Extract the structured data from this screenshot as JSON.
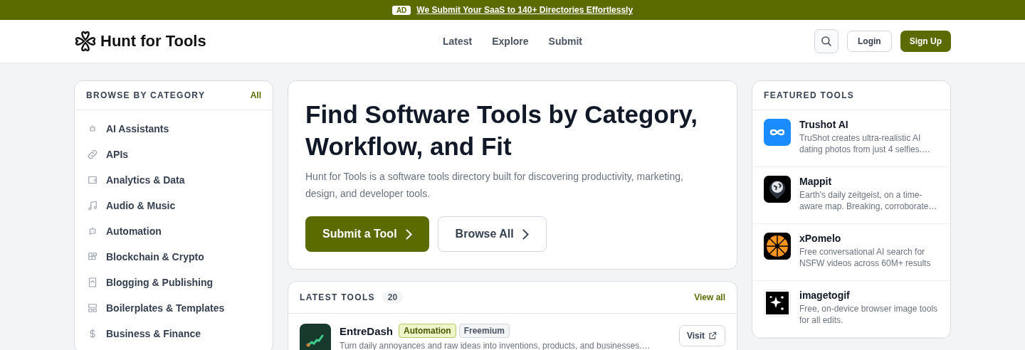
{
  "ad_banner": {
    "badge": "AD",
    "link": "We Submit Your SaaS to 140+ Directories Effortlessly"
  },
  "header": {
    "brand": "Hunt for Tools",
    "nav": [
      {
        "label": "Latest"
      },
      {
        "label": "Explore"
      },
      {
        "label": "Submit"
      }
    ],
    "login": "Login",
    "signup": "Sign Up"
  },
  "categories": {
    "title": "BROWSE BY CATEGORY",
    "all_link": "All",
    "items": [
      {
        "label": "AI Assistants"
      },
      {
        "label": "APIs"
      },
      {
        "label": "Analytics & Data"
      },
      {
        "label": "Audio & Music"
      },
      {
        "label": "Automation"
      },
      {
        "label": "Blockchain & Crypto"
      },
      {
        "label": "Blogging & Publishing"
      },
      {
        "label": "Boilerplates & Templates"
      },
      {
        "label": "Business & Finance"
      }
    ]
  },
  "hero": {
    "title": "Find Software Tools by Category, Workflow, and Fit",
    "description": "Hunt for Tools is a software tools directory built for discovering productivity, marketing, design, and developer tools.",
    "primary_button": "Submit a Tool",
    "secondary_button": "Browse All"
  },
  "latest": {
    "title": "LATEST TOOLS",
    "count": "20",
    "view_all": "View all",
    "items": [
      {
        "name": "EntreDash",
        "tags": [
          {
            "label": "Automation",
            "kind": "category"
          },
          {
            "label": "Freemium",
            "kind": "pricing"
          }
        ],
        "description": "Turn daily annoyances and raw ideas into inventions, products, and businesses.…",
        "action": "Visit"
      }
    ]
  },
  "featured": {
    "title": "FEATURED TOOLS",
    "items": [
      {
        "name": "Trushot AI",
        "description": "TruShot creates ultra-realistic AI dating photos from just 4 selfies.…"
      },
      {
        "name": "Mappit",
        "description": "Earth's daily zeitgeist, on a time-aware map. Breaking, corroborate…"
      },
      {
        "name": "xPomelo",
        "description": "Free conversational AI search for NSFW videos across 60M+ results"
      },
      {
        "name": "imagetogif",
        "description": "Free, on-device browser image tools for all edits."
      }
    ]
  }
}
